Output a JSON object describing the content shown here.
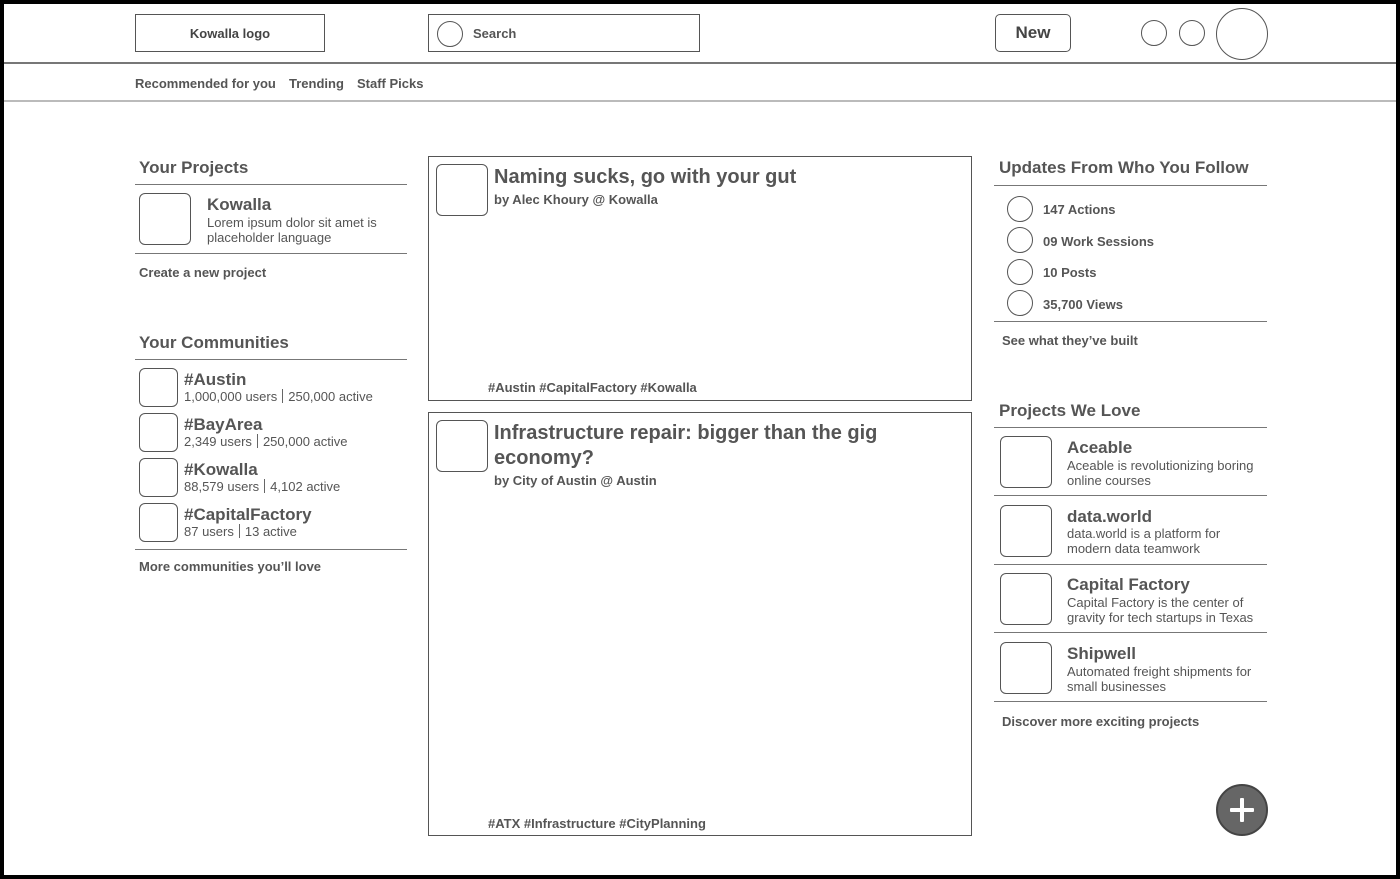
{
  "header": {
    "logo": "Kowalla logo",
    "search_placeholder": "Search",
    "new_button": "New"
  },
  "nav": {
    "tabs": [
      "Recommended for you",
      "Trending",
      "Staff Picks"
    ]
  },
  "projects": {
    "title": "Your Projects",
    "items": [
      {
        "name": "Kowalla",
        "desc_line1": "Lorem ipsum dolor sit amet is",
        "desc_line2": "placeholder language"
      }
    ],
    "create_link": "Create a new project"
  },
  "communities": {
    "title": "Your Communities",
    "items": [
      {
        "name": "#Austin",
        "users": "1,000,000 users",
        "active": "250,000 active"
      },
      {
        "name": "#BayArea",
        "users": "2,349 users",
        "active": "250,000 active"
      },
      {
        "name": "#Kowalla",
        "users": "88,579 users",
        "active": "4,102 active"
      },
      {
        "name": "#CapitalFactory",
        "users": "87 users",
        "active": "13 active"
      }
    ],
    "more_link": "More communities you’ll love"
  },
  "feed": {
    "posts": [
      {
        "title_line1": "Naming sucks, go with your gut",
        "title_line2": "",
        "byline": "by Alec Khoury @ Kowalla",
        "tags": "#Austin #CapitalFactory #Kowalla"
      },
      {
        "title_line1": "Infrastructure repair: bigger than the gig",
        "title_line2": "economy?",
        "byline": "by City of Austin @ Austin",
        "tags": "#ATX #Infrastructure #CityPlanning"
      }
    ]
  },
  "updates": {
    "title": "Updates From Who You Follow",
    "stats": [
      "147 Actions",
      "09 Work Sessions",
      "10 Posts",
      "35,700 Views"
    ],
    "see_link": "See what they’ve built"
  },
  "loved": {
    "title": "Projects We Love",
    "items": [
      {
        "name": "Aceable",
        "desc_line1": "Aceable is revolutionizing boring",
        "desc_line2": "online courses"
      },
      {
        "name": "data.world",
        "desc_line1": "data.world is a platform for",
        "desc_line2": "modern data teamwork"
      },
      {
        "name": "Capital Factory",
        "desc_line1": "Capital Factory is the center of",
        "desc_line2": "gravity for tech startups in Texas"
      },
      {
        "name": "Shipwell",
        "desc_line1": "Automated freight shipments for",
        "desc_line2": "small businesses"
      }
    ],
    "discover_link": "Discover more exciting projects"
  },
  "icons": {
    "search": "search-icon",
    "fab": "plus-icon"
  }
}
